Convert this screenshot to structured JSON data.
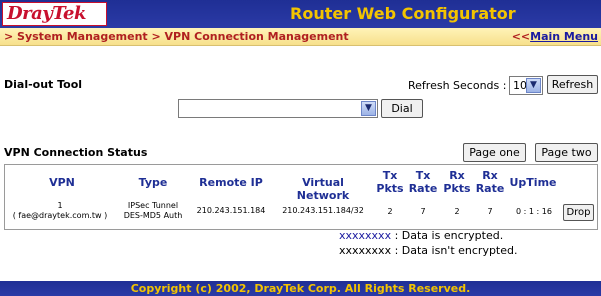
{
  "header": {
    "logo_text": "DrayTek",
    "title": "Router Web Configurator"
  },
  "breadcrumb": {
    "path": "> System Management > VPN Connection Management",
    "main_menu_prefix": "<<",
    "main_menu_label": "Main Menu"
  },
  "dialout": {
    "title": "Dial-out Tool",
    "refresh_label": "Refresh Seconds :",
    "refresh_value": "10",
    "refresh_button": "Refresh",
    "profile_value": "",
    "dial_button": "Dial"
  },
  "status": {
    "title": "VPN Connection Status",
    "page_one_button": "Page one",
    "page_two_button": "Page two",
    "columns": {
      "vpn": "VPN",
      "type": "Type",
      "remote_ip": "Remote IP",
      "virtual_network": "Virtual Network",
      "tx_pkts_1": "Tx",
      "tx_pkts_2": "Pkts",
      "tx_rate_1": "Tx",
      "tx_rate_2": "Rate",
      "rx_pkts_1": "Rx",
      "rx_pkts_2": "Pkts",
      "rx_rate_1": "Rx",
      "rx_rate_2": "Rate",
      "uptime": "UpTime"
    },
    "rows": [
      {
        "vpn_index": "1",
        "vpn_name": "( fae@draytek.com.tw )",
        "type_line1": "IPSec Tunnel",
        "type_line2": "DES-MD5 Auth",
        "remote_ip": "210.243.151.184",
        "virtual_network": "210.243.151.184/32",
        "tx_pkts": "2",
        "tx_rate": "7",
        "rx_pkts": "2",
        "rx_rate": "7",
        "uptime": "0 : 1 : 16",
        "drop_button": "Drop"
      }
    ]
  },
  "legend": {
    "encrypted_sample": "xxxxxxxx",
    "encrypted_text": ": Data is encrypted.",
    "unencrypted_sample": "xxxxxxxx",
    "unencrypted_text": ": Data isn't encrypted.",
    "encrypted_color": "#1a1aa0",
    "unencrypted_color": "#000000"
  },
  "footer": {
    "copyright": "Copyright (c) 2002, DrayTek Corp. All Rights Reserved."
  },
  "colors": {
    "header_bg": "#2434a0",
    "header_title": "#f3c400",
    "breadcrumb_text": "#b02020",
    "column_header": "#1f2f95"
  }
}
